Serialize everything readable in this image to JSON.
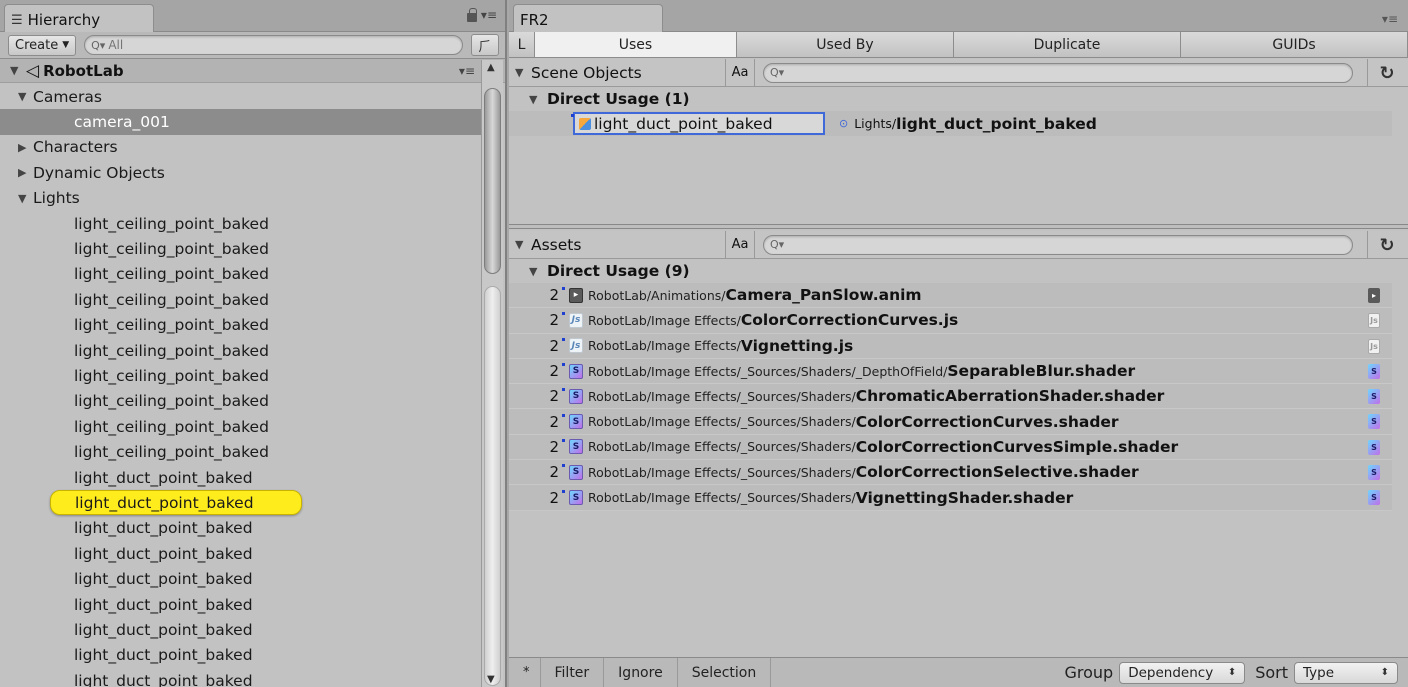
{
  "hierarchy": {
    "tab_title": "Hierarchy",
    "create_label": "Create",
    "search_placeholder": "All",
    "root_name": "RobotLab",
    "rows": [
      {
        "label": "Cameras",
        "level": 1,
        "expanded": true
      },
      {
        "label": "camera_001",
        "level": 2,
        "selected": true
      },
      {
        "label": "Characters",
        "level": 1,
        "expanded": false
      },
      {
        "label": "Dynamic Objects",
        "level": 1,
        "expanded": false
      },
      {
        "label": "Lights",
        "level": 1,
        "expanded": true
      },
      {
        "label": "light_ceiling_point_baked",
        "level": 2
      },
      {
        "label": "light_ceiling_point_baked",
        "level": 2
      },
      {
        "label": "light_ceiling_point_baked",
        "level": 2
      },
      {
        "label": "light_ceiling_point_baked",
        "level": 2
      },
      {
        "label": "light_ceiling_point_baked",
        "level": 2
      },
      {
        "label": "light_ceiling_point_baked",
        "level": 2
      },
      {
        "label": "light_ceiling_point_baked",
        "level": 2
      },
      {
        "label": "light_ceiling_point_baked",
        "level": 2
      },
      {
        "label": "light_ceiling_point_baked",
        "level": 2
      },
      {
        "label": "light_ceiling_point_baked",
        "level": 2
      },
      {
        "label": "light_duct_point_baked",
        "level": 2
      },
      {
        "label": "light_duct_point_baked",
        "level": 2,
        "highlighted": true
      },
      {
        "label": "light_duct_point_baked",
        "level": 2
      },
      {
        "label": "light_duct_point_baked",
        "level": 2
      },
      {
        "label": "light_duct_point_baked",
        "level": 2
      },
      {
        "label": "light_duct_point_baked",
        "level": 2
      },
      {
        "label": "light_duct_point_baked",
        "level": 2
      },
      {
        "label": "light_duct_point_baked",
        "level": 2
      },
      {
        "label": "light_duct_point_baked",
        "level": 2
      }
    ]
  },
  "fr2": {
    "tab_title": "FR2",
    "tabs": [
      {
        "label": "L",
        "active": false,
        "width": 26
      },
      {
        "label": "Uses",
        "active": true,
        "width": 202
      },
      {
        "label": "Used By",
        "active": false,
        "width": 217
      },
      {
        "label": "Duplicate",
        "active": false,
        "width": 227
      },
      {
        "label": "GUIDs",
        "active": false,
        "width": 227
      }
    ],
    "scene": {
      "header": "Scene Objects",
      "aa_label": "Aa",
      "group_label": "Direct Usage (1)",
      "item_name": "light_duct_point_baked",
      "item_path": "Lights/",
      "item_file": "light_duct_point_baked"
    },
    "assets": {
      "header": "Assets",
      "aa_label": "Aa",
      "group_label": "Direct Usage (9)",
      "rows": [
        {
          "count": "2",
          "type": "anim",
          "icon_text": "▸",
          "path": "RobotLab/Animations/",
          "file": "Camera_PanSlow.anim"
        },
        {
          "count": "2",
          "type": "js",
          "icon_text": "Js",
          "path": "RobotLab/Image Effects/",
          "file": "ColorCorrectionCurves.js"
        },
        {
          "count": "2",
          "type": "js",
          "icon_text": "Js",
          "path": "RobotLab/Image Effects/",
          "file": "Vignetting.js"
        },
        {
          "count": "2",
          "type": "shader",
          "icon_text": "S",
          "path": "RobotLab/Image Effects/_Sources/Shaders/_DepthOfField/",
          "file": "SeparableBlur.shader"
        },
        {
          "count": "2",
          "type": "shader",
          "icon_text": "S",
          "path": "RobotLab/Image Effects/_Sources/Shaders/",
          "file": "ChromaticAberrationShader.shader"
        },
        {
          "count": "2",
          "type": "shader",
          "icon_text": "S",
          "path": "RobotLab/Image Effects/_Sources/Shaders/",
          "file": "ColorCorrectionCurves.shader"
        },
        {
          "count": "2",
          "type": "shader",
          "icon_text": "S",
          "path": "RobotLab/Image Effects/_Sources/Shaders/",
          "file": "ColorCorrectionCurvesSimple.shader"
        },
        {
          "count": "2",
          "type": "shader",
          "icon_text": "S",
          "path": "RobotLab/Image Effects/_Sources/Shaders/",
          "file": "ColorCorrectionSelective.shader"
        },
        {
          "count": "2",
          "type": "shader",
          "icon_text": "S",
          "path": "RobotLab/Image Effects/_Sources/Shaders/",
          "file": "VignettingShader.shader"
        }
      ]
    },
    "bottom": {
      "star_label": "*",
      "filter_label": "Filter",
      "ignore_label": "Ignore",
      "selection_label": "Selection",
      "group_label": "Group",
      "group_value": "Dependency",
      "sort_label": "Sort",
      "sort_value": "Type"
    }
  },
  "colors": {
    "highlight": "#ffec1c",
    "selection_border": "#3f68d8",
    "selected_row": "#8c8c8c"
  }
}
